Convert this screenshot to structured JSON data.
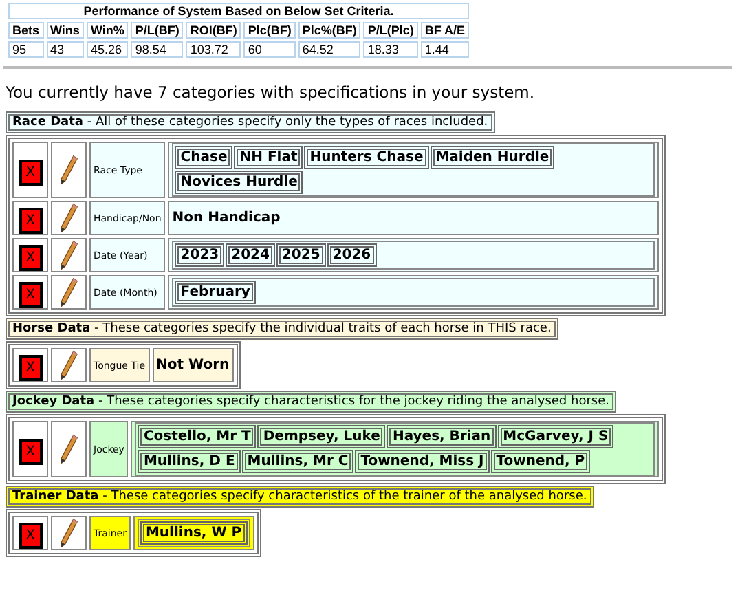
{
  "performance": {
    "title": "Performance of System Based on Below Set Criteria.",
    "columns": [
      "Bets",
      "Wins",
      "Win%",
      "P/L(BF)",
      "ROI(BF)",
      "Plc(BF)",
      "Plc%(BF)",
      "P/L(Plc)",
      "BF A/E"
    ],
    "values": [
      "95",
      "43",
      "45.26",
      "98.54",
      "103.72",
      "60",
      "64.52",
      "18.33",
      "1.44"
    ]
  },
  "summary": "You currently have 7 categories with specifications in your system.",
  "sections": [
    {
      "title": "Race Data",
      "description": "- All of these categories specify only the types of races included.",
      "color": "#f0ffff",
      "categories": [
        {
          "delete": "X",
          "label": "Race Type",
          "kind": "tags",
          "values": [
            "Chase",
            "NH Flat",
            "Hunters Chase",
            "Maiden Hurdle",
            "Novices Hurdle"
          ]
        },
        {
          "delete": "X",
          "label": "Handicap/Non",
          "kind": "plain",
          "values": [
            "Non Handicap"
          ]
        },
        {
          "delete": "X",
          "label": "Date (Year)",
          "kind": "tags",
          "values": [
            "2023",
            "2024",
            "2025",
            "2026"
          ]
        },
        {
          "delete": "X",
          "label": "Date (Month)",
          "kind": "tags",
          "values": [
            "February"
          ]
        }
      ]
    },
    {
      "title": "Horse Data",
      "description": "- These categories specify the individual traits of each horse in THIS race.",
      "color": "#fff8dc",
      "categories": [
        {
          "delete": "X",
          "label": "Tongue Tie",
          "kind": "plain",
          "values": [
            "Not Worn"
          ]
        }
      ]
    },
    {
      "title": "Jockey Data",
      "description": "- These categories specify characteristics for the jockey riding the analysed horse.",
      "color": "#ccffcc",
      "categories": [
        {
          "delete": "X",
          "label": "Jockey",
          "kind": "tags",
          "values": [
            "Costello, Mr T",
            "Dempsey, Luke",
            "Hayes, Brian",
            "McGarvey, J S",
            "Mullins, D E",
            "Mullins, Mr C",
            "Townend, Miss J",
            "Townend, P"
          ]
        }
      ]
    },
    {
      "title": "Trainer Data",
      "description": "- These categories specify characteristics of the trainer of the analysed horse.",
      "color": "#ffff00",
      "categories": [
        {
          "delete": "X",
          "label": "Trainer",
          "kind": "tags",
          "values": [
            "Mullins, W P"
          ]
        }
      ]
    }
  ]
}
